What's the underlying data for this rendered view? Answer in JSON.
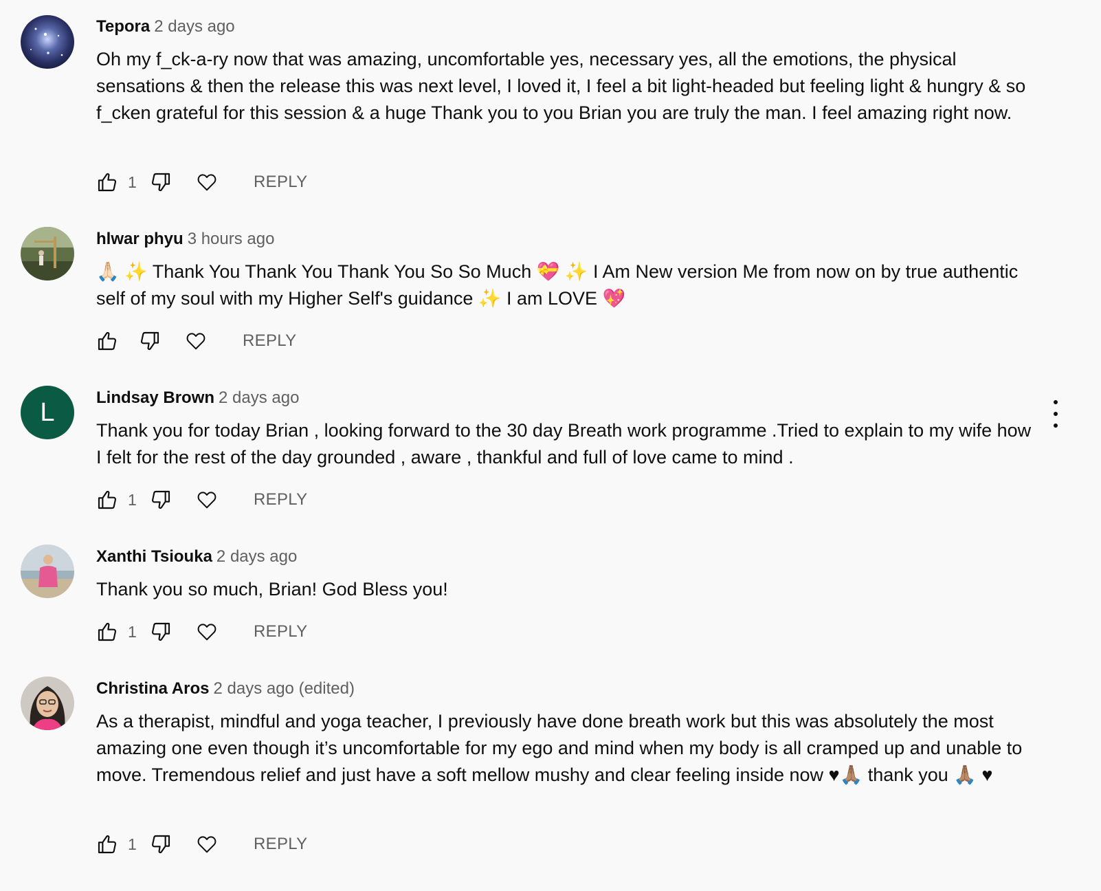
{
  "comments": [
    {
      "author": "Tepora",
      "time": "2 days ago",
      "text": "Oh my f_ck-a-ry now that was amazing, uncomfortable yes, necessary yes, all the emotions, the physical sensations & then the release this was next level, I loved it, I feel a bit light-headed but feeling light & hungry & so f_cken grateful for this session & a huge Thank you to you Brian you are truly the man. I feel amazing right now.",
      "likes": "1",
      "reply_label": "REPLY"
    },
    {
      "author": "hlwar phyu",
      "time": "3 hours ago",
      "text": "🙏🏻 ✨ Thank You Thank You Thank You So So Much 💝 ✨  I Am New version Me from now on by true authentic self of my soul with my Higher Self's guidance ✨ I am LOVE 💖",
      "likes": "",
      "reply_label": "REPLY"
    },
    {
      "author": "Lindsay Brown",
      "time": "2 days ago",
      "avatar_letter": "L",
      "text": "Thank you for today Brian , looking forward to the 30 day Breath work programme .Tried  to explain to my wife how I felt for the rest of the day grounded , aware , thankful and full of love came to mind .",
      "likes": "1",
      "reply_label": "REPLY"
    },
    {
      "author": "Xanthi Tsiouka",
      "time": "2 days ago",
      "text": "Thank you so much, Brian! God Bless you!",
      "likes": "1",
      "reply_label": "REPLY"
    },
    {
      "author": "Christina Aros",
      "time": "2 days ago (edited)",
      "text": "As a therapist, mindful and yoga teacher, I previously have done breath work but this was absolutely the most amazing one even though it’s uncomfortable for my ego and mind when my body is all cramped up and unable to move. Tremendous relief and just have a soft mellow mushy and clear feeling inside now ♥🙏🏽 thank you 🙏🏽  ♥",
      "likes": "1",
      "reply_label": "REPLY"
    }
  ],
  "icons": {
    "like": "thumbs-up-icon",
    "dislike": "thumbs-down-icon",
    "heart": "heart-icon",
    "menu": "more-vert-icon"
  }
}
